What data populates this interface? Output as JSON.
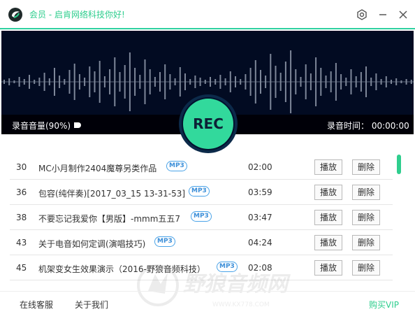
{
  "window": {
    "title": "会员 - 启肯网络科技你好!",
    "icons": [
      "app-logo-icon",
      "gear-icon",
      "minimize-icon",
      "close-icon"
    ],
    "accent_color": "#2fce8e"
  },
  "recorder": {
    "volume_label": "录音音量(90%)",
    "volume_percent": 90,
    "time_label": "录音时间：  00:00:00",
    "rec_label": "REC"
  },
  "recordings": [
    {
      "index": "30",
      "name": "MC小月制作2404魔尊另类作品",
      "format": "MP3",
      "duration": "02:00",
      "play": "播放",
      "delete": "删除"
    },
    {
      "index": "36",
      "name": "包容(纯伴奏)[2017_03_15 13-31-53]",
      "format": "MP3",
      "duration": "03:59",
      "play": "播放",
      "delete": "删除"
    },
    {
      "index": "38",
      "name": "不要忘记我爱你【男版】-mmm五五7",
      "format": "MP3",
      "duration": "03:47",
      "play": "播放",
      "delete": "删除"
    },
    {
      "index": "43",
      "name": "关于电音如何定调(演唱技巧)",
      "format": "MP3",
      "duration": "04:24",
      "play": "播放",
      "delete": "删除"
    },
    {
      "index": "45",
      "name": "机架变女生效果演示（2016-野狼音频科技）",
      "format": "MP3",
      "duration": "02:08",
      "play": "播放",
      "delete": "删除"
    }
  ],
  "footer": {
    "service": "在线客服",
    "about": "关于我们",
    "vip": "购买VIP"
  },
  "watermark": {
    "text": "野狼音频网",
    "url": "WWW.KX778.COM"
  }
}
